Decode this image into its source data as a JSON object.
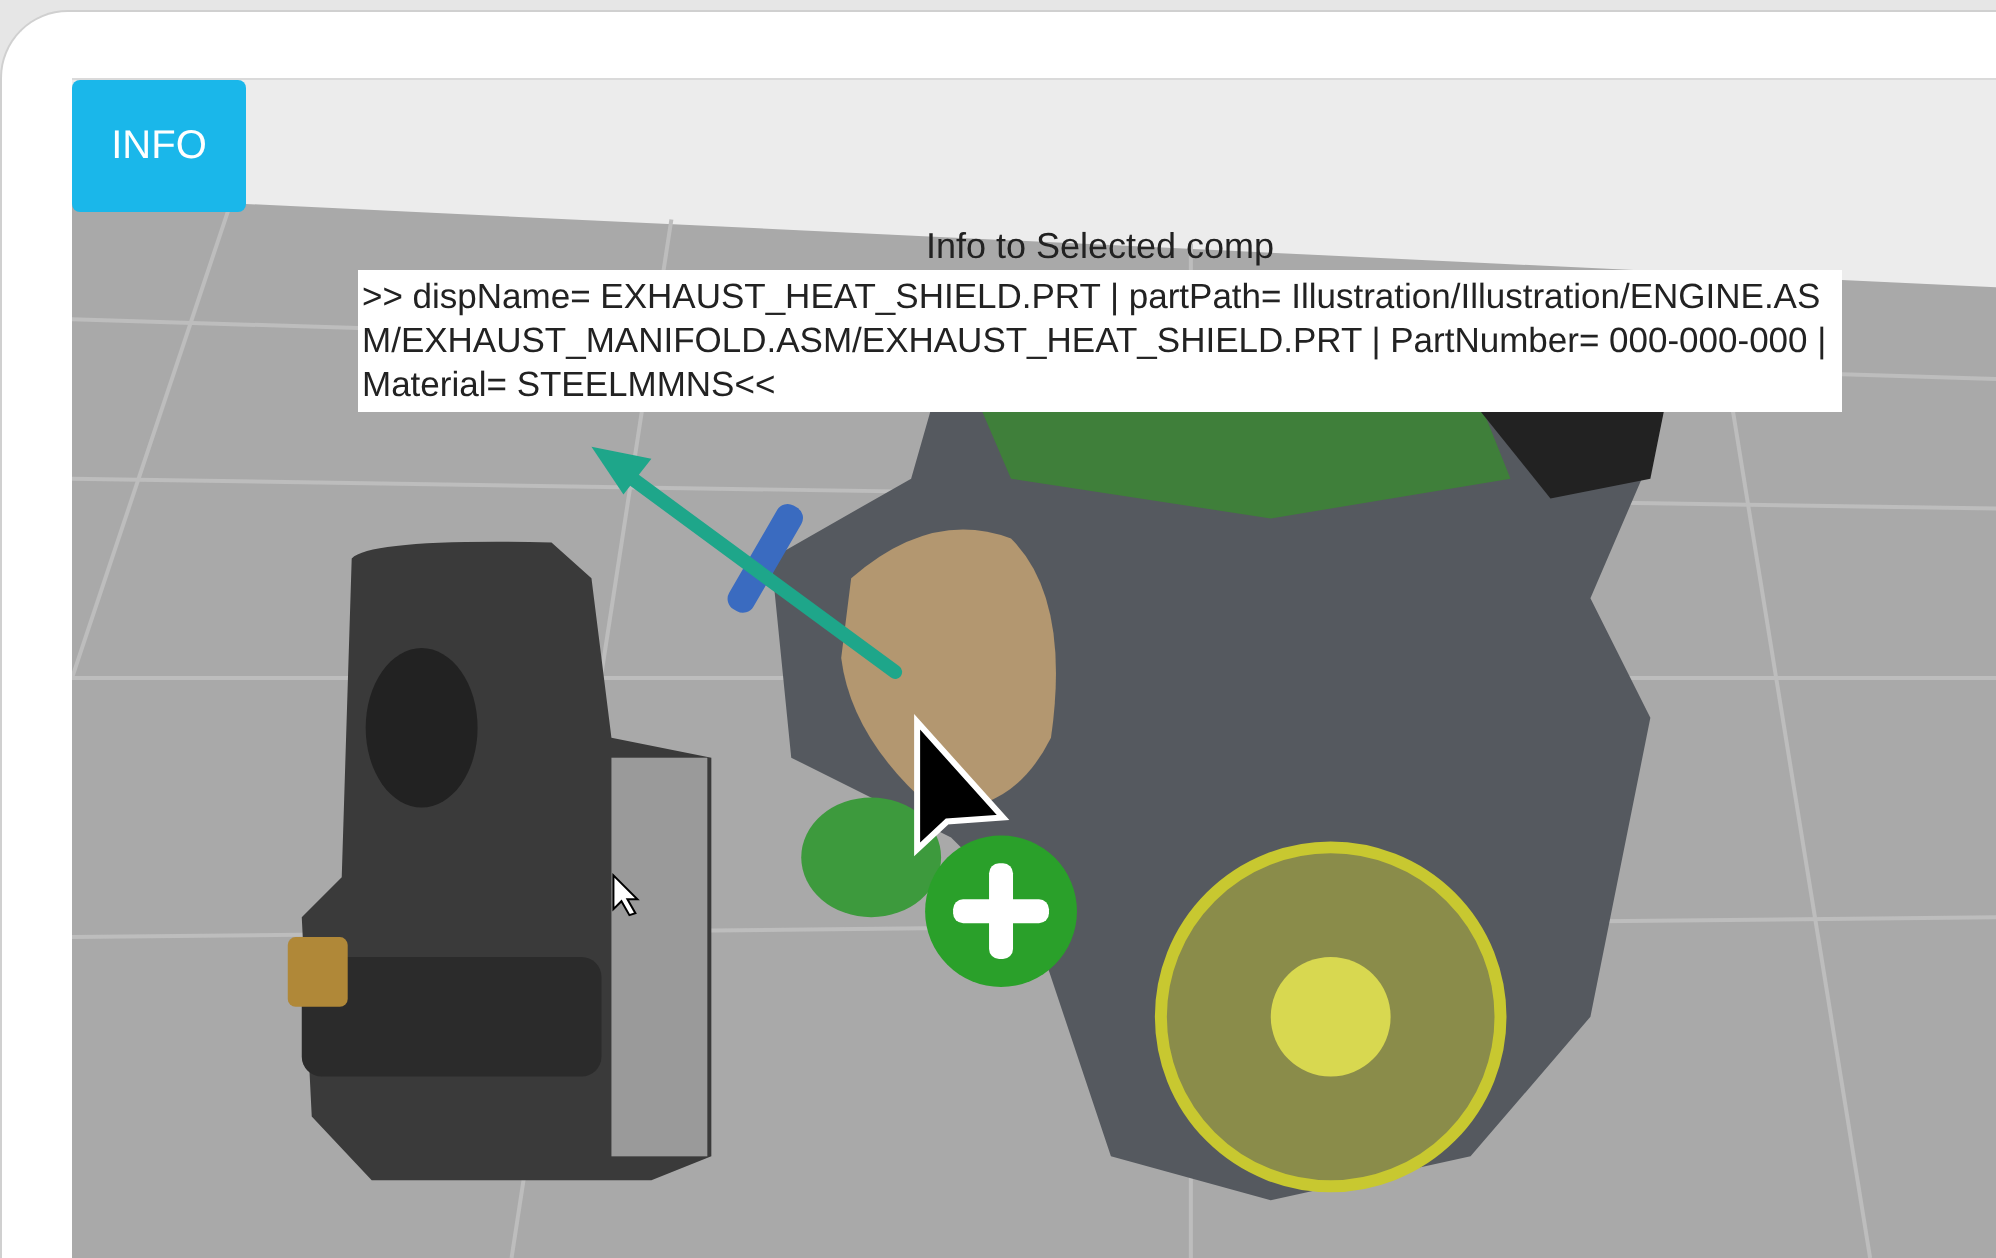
{
  "info_button": {
    "label": "INFO"
  },
  "info_panel": {
    "title": "Info to Selected comp",
    "text": ">> dispName= EXHAUST_HEAT_SHIELD.PRT | partPath= Illustration/Illustration/ENGINE.ASM/EXHAUST_MANIFOLD.ASM/EXHAUST_HEAT_SHIELD.PRT | PartNumber= 000-000-000 | Material= STEELMMNS<<"
  }
}
